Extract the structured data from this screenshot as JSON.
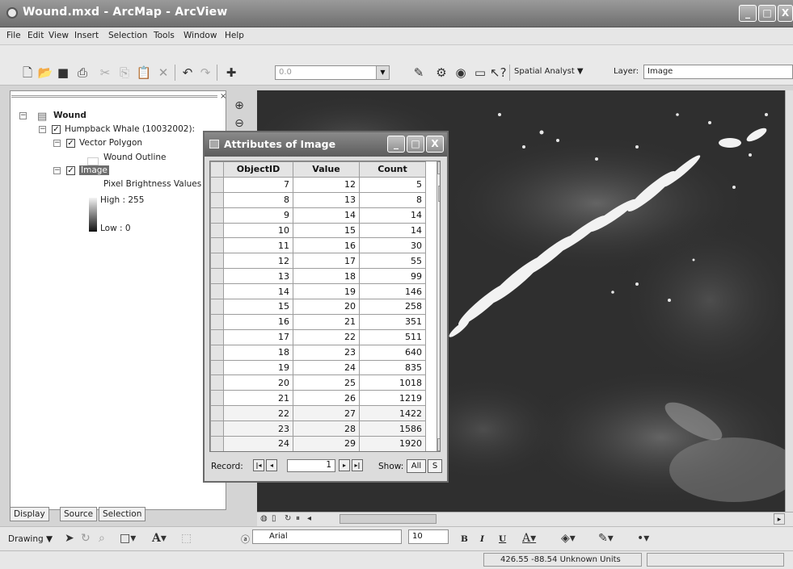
{
  "app": {
    "title": "Wound.mxd - ArcMap - ArcView",
    "controls": {
      "minimize": "_",
      "maximize": "□",
      "close": "X"
    }
  },
  "menu": [
    "File",
    "Edit",
    "View",
    "Insert",
    "Selection",
    "Tools",
    "Window",
    "Help"
  ],
  "toolbar": {
    "scale": "0.0",
    "spatial_analyst": "Spatial Analyst ▼",
    "layer_label": "Layer:",
    "layer_value": "Image"
  },
  "toc": {
    "root": "Wound",
    "dataset": "Humpback Whale (10032002):",
    "vector_layer": "Vector Polygon",
    "vector_legend": "Wound Outline",
    "image_layer": "Image",
    "image_legend_title": "Pixel Brightness Values",
    "high": "High : 255",
    "low": "Low : 0",
    "tabs": [
      "Display",
      "Source",
      "Selection"
    ]
  },
  "attributes": {
    "title": "Attributes of Image",
    "columns": [
      "ObjectID",
      "Value",
      "Count"
    ],
    "rows": [
      [
        "7",
        "12",
        "5"
      ],
      [
        "8",
        "13",
        "8"
      ],
      [
        "9",
        "14",
        "14"
      ],
      [
        "10",
        "15",
        "14"
      ],
      [
        "11",
        "16",
        "30"
      ],
      [
        "12",
        "17",
        "55"
      ],
      [
        "13",
        "18",
        "99"
      ],
      [
        "14",
        "19",
        "146"
      ],
      [
        "15",
        "20",
        "258"
      ],
      [
        "16",
        "21",
        "351"
      ],
      [
        "17",
        "22",
        "511"
      ],
      [
        "18",
        "23",
        "640"
      ],
      [
        "19",
        "24",
        "835"
      ],
      [
        "20",
        "25",
        "1018"
      ],
      [
        "21",
        "26",
        "1219"
      ],
      [
        "22",
        "27",
        "1422"
      ],
      [
        "23",
        "28",
        "1586"
      ],
      [
        "24",
        "29",
        "1920"
      ]
    ],
    "record_label": "Record:",
    "record_value": "1",
    "show_label": "Show:",
    "show_all": "All",
    "show_selected": "S"
  },
  "drawing": {
    "label": "Drawing ▼",
    "font": "Arial",
    "size": "10",
    "bold": "B",
    "italic": "I",
    "underline": "U"
  },
  "status": {
    "coordinates": "426.55  -88.54 Unknown Units"
  }
}
